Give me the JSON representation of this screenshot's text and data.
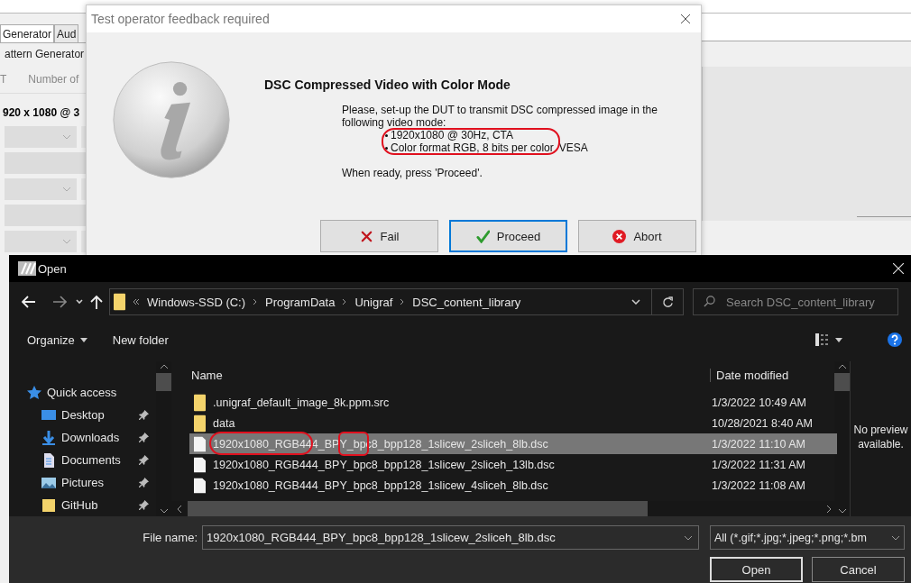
{
  "background_app": {
    "tabs": [
      {
        "label": "Generator",
        "selected": true
      },
      {
        "label": "Aud",
        "selected": false
      }
    ],
    "group_label": "attern Generator",
    "field_labels": [
      "T",
      "Number of"
    ],
    "resolution": "920 x 1080 @ 3"
  },
  "feedback_dialog": {
    "title": "Test operator feedback required",
    "heading": "DSC Compressed Video with Color Mode",
    "intro": "Please, set-up the DUT to transmit DSC compressed image in the following video mode:",
    "bullets": [
      {
        "text": "1920x1080 @ 30Hz, CTA"
      },
      {
        "text": "Color format RGB, 8 bits per color",
        "note": "VESA"
      }
    ],
    "bullets_annotated": true,
    "closing": "When ready, press 'Proceed'.",
    "buttons": [
      {
        "label": "Fail",
        "kind": "fail",
        "focused": false
      },
      {
        "label": "Proceed",
        "kind": "proceed",
        "focused": true
      },
      {
        "label": "Abort",
        "kind": "abort",
        "focused": false
      }
    ]
  },
  "open_dialog": {
    "title": "Open",
    "path": [
      "Windows-SSD (C:)",
      "ProgramData",
      "Unigraf",
      "DSC_content_library"
    ],
    "search_placeholder": "Search DSC_content_library",
    "toolbar": [
      {
        "label": "Organize",
        "dropdown": true
      },
      {
        "label": "New folder",
        "dropdown": false
      }
    ],
    "nav": [
      {
        "label": "Quick access",
        "kind": "star",
        "pinned": false
      },
      {
        "label": "Desktop",
        "kind": "desktop",
        "pinned": true
      },
      {
        "label": "Downloads",
        "kind": "downloads",
        "pinned": true
      },
      {
        "label": "Documents",
        "kind": "documents",
        "pinned": true
      },
      {
        "label": "Pictures",
        "kind": "pictures",
        "pinned": true
      },
      {
        "label": "GitHub",
        "kind": "folder",
        "pinned": true
      }
    ],
    "columns": [
      "Name",
      "Date modified"
    ],
    "files": [
      {
        "name": ".unigraf_default_image_8k.ppm.src",
        "date": "1/3/2022 10:49 AM",
        "kind": "folder",
        "selected": false,
        "annotated": false
      },
      {
        "name": "data",
        "date": "10/28/2021 8:40 AM",
        "kind": "folder",
        "selected": false,
        "annotated": false
      },
      {
        "name": "1920x1080_RGB444_BPY_bpc8_bpp128_1slicew_2sliceh_8lb.dsc",
        "date": "1/3/2022 11:10 AM",
        "kind": "file",
        "selected": true,
        "annotated": true
      },
      {
        "name": "1920x1080_RGB444_BPY_bpc8_bpp128_1slicew_2sliceh_13lb.dsc",
        "date": "1/3/2022 11:31 AM",
        "kind": "file",
        "selected": false,
        "annotated": false
      },
      {
        "name": "1920x1080_RGB444_BPY_bpc8_bpp128_1slicew_4sliceh_8lb.dsc",
        "date": "1/3/2022 11:08 AM",
        "kind": "file",
        "selected": false,
        "annotated": false
      }
    ],
    "preview": "No preview available.",
    "file_name_label": "File name:",
    "file_name": "1920x1080_RGB444_BPY_bpc8_bpp128_1slicew_2sliceh_8lb.dsc",
    "file_type": "All (*.gif;*.jpg;*.jpeg;*.png;*.bm",
    "buttons": [
      {
        "label": "Open",
        "default": true
      },
      {
        "label": "Cancel",
        "default": false
      }
    ]
  }
}
